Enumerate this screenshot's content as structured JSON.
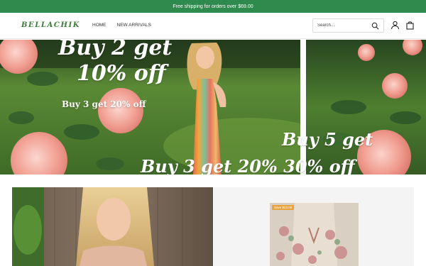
{
  "promo": {
    "text": "Free shipping for orders over $69.00"
  },
  "brand": {
    "name": "BELLACHIK"
  },
  "nav": {
    "items": [
      "HOME",
      "NEW ARRIVALS"
    ]
  },
  "search": {
    "placeholder": "Search...",
    "value": ""
  },
  "icons": {
    "search": "search-icon",
    "account": "user-icon",
    "cart": "shopping-bag-icon"
  },
  "hero": {
    "left": {
      "headline_line1": "Buy 2 get",
      "headline_line2": "10% off",
      "subline": "Buy 3 get 20% off"
    },
    "bottom_banner": "Buy 3 get 20% 30% off",
    "right": {
      "headline": "Buy 5 get"
    }
  },
  "products": {
    "right_badge": "Save $23.00"
  },
  "colors": {
    "promo_bg": "#2f8a4d",
    "logo": "#3c7d3a",
    "badge": "#e9a33b"
  }
}
